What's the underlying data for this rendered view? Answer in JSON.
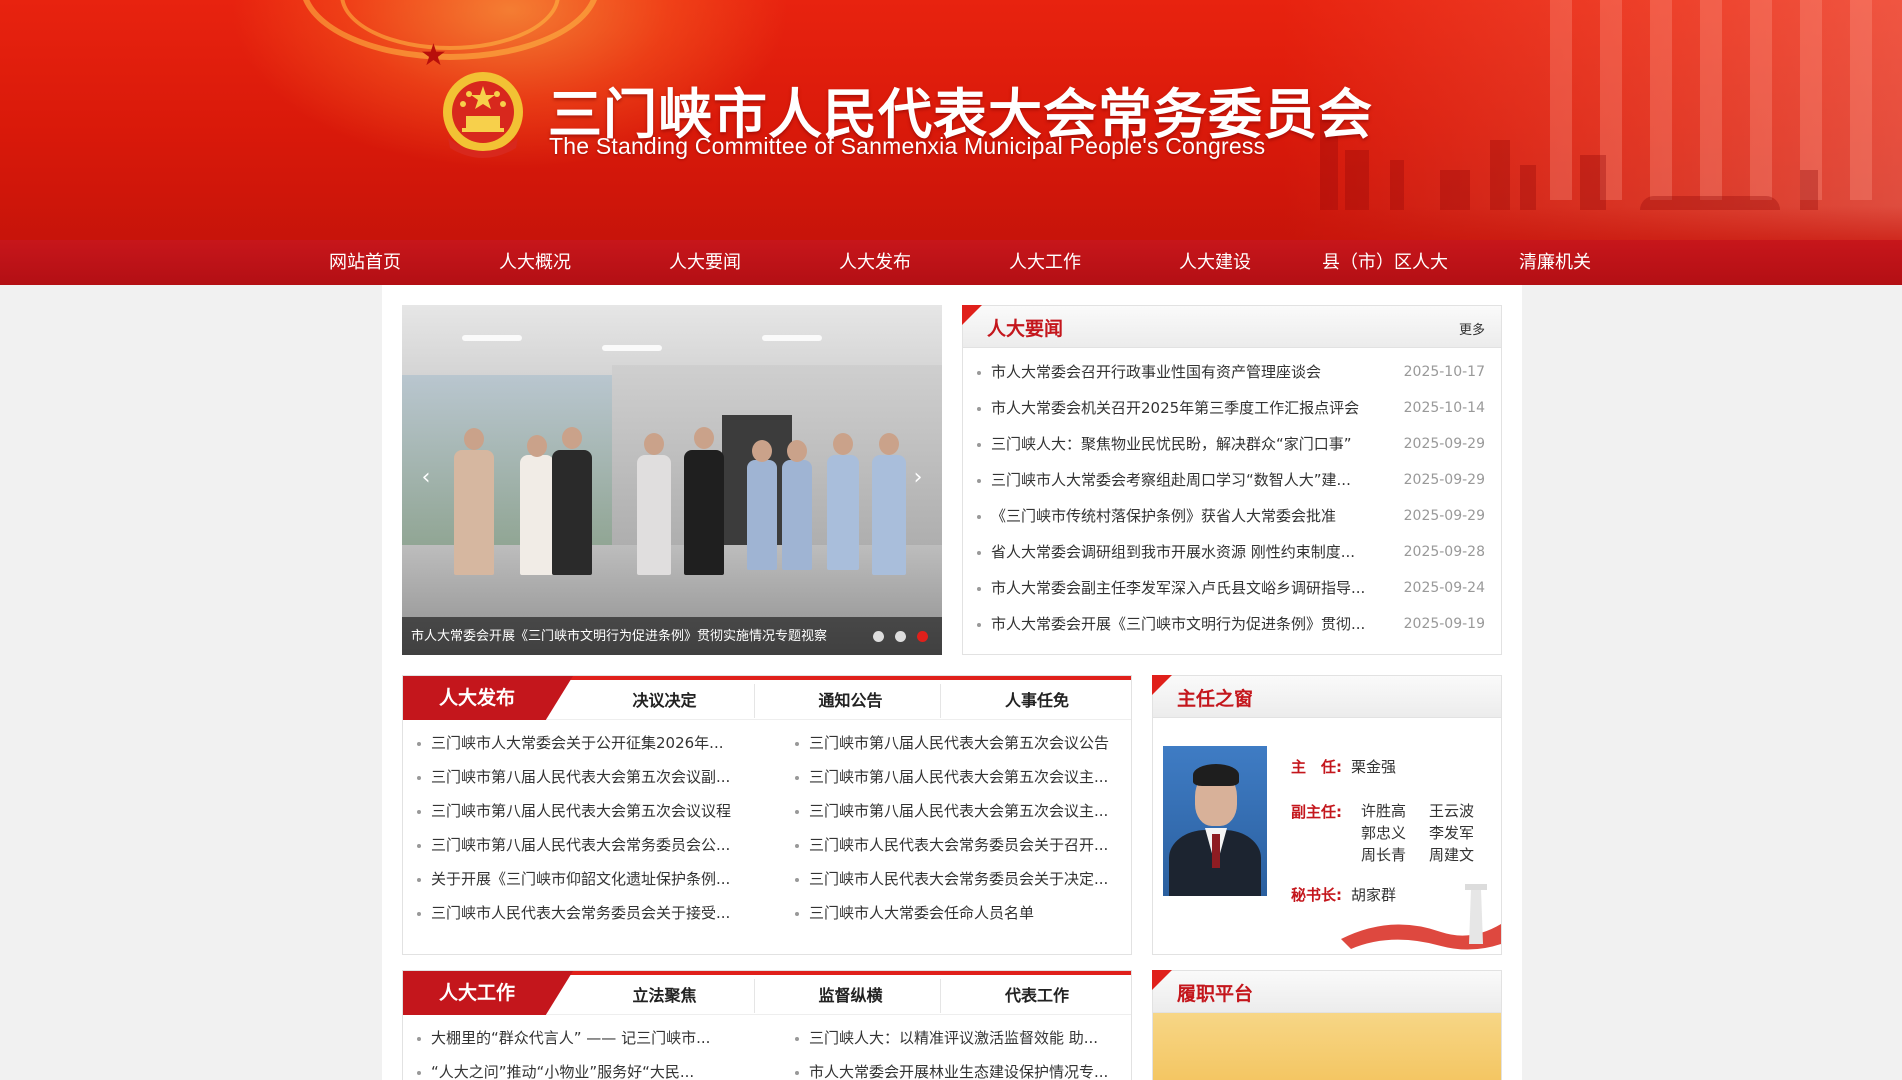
{
  "header": {
    "title_cn": "三门峡市人民代表大会常务委员会",
    "title_en": "The Standing Committee of Sanmenxia Municipal People's Congress"
  },
  "nav": {
    "items": [
      "网站首页",
      "人大概况",
      "人大要闻",
      "人大发布",
      "人大工作",
      "人大建设",
      "县（市）区人大",
      "清廉机关"
    ]
  },
  "slider": {
    "caption": "市人大常委会开展《三门峡市文明行为促进条例》贯彻实施情况专题视察",
    "dots": 3,
    "active_dot": 3
  },
  "news": {
    "title": "人大要闻",
    "more": "更多",
    "items": [
      {
        "title": "市人大常委会召开行政事业性国有资产管理座谈会",
        "date": "2025-10-17"
      },
      {
        "title": "市人大常委会机关召开2025年第三季度工作汇报点评会",
        "date": "2025-10-14"
      },
      {
        "title": "三门峡人大：聚焦物业民忧民盼，解决群众“家门口事”",
        "date": "2025-09-29"
      },
      {
        "title": "三门峡市人大常委会考察组赴周口学习“数智人大”建...",
        "date": "2025-09-29"
      },
      {
        "title": "《三门峡市传统村落保护条例》获省人大常委会批准",
        "date": "2025-09-29"
      },
      {
        "title": "省人大常委会调研组到我市开展水资源 刚性约束制度...",
        "date": "2025-09-28"
      },
      {
        "title": "市人大常委会副主任李发军深入卢氏县文峪乡调研指导...",
        "date": "2025-09-24"
      },
      {
        "title": "市人大常委会开展《三门峡市文明行为促进条例》贯彻...",
        "date": "2025-09-19"
      }
    ]
  },
  "publish": {
    "title": "人大发布",
    "tabs": [
      "决议决定",
      "通知公告",
      "人事任免"
    ],
    "left": [
      "三门峡市人大常委会关于公开征集2026年...",
      "三门峡市第八届人民代表大会第五次会议副...",
      "三门峡市第八届人民代表大会第五次会议议程",
      "三门峡市第八届人民代表大会常务委员会公...",
      "关于开展《三门峡市仰韶文化遗址保护条例...",
      "三门峡市人民代表大会常务委员会关于接受..."
    ],
    "right": [
      "三门峡市第八届人民代表大会第五次会议公告",
      "三门峡市第八届人民代表大会第五次会议主...",
      "三门峡市第八届人民代表大会第五次会议主...",
      "三门峡市人民代表大会常务委员会关于召开...",
      "三门峡市人民代表大会常务委员会关于决定...",
      "三门峡市人大常委会任命人员名单"
    ]
  },
  "director": {
    "title": "主任之窗",
    "director_label": "主　任:",
    "director_name": "栗金强",
    "deputy_label": "副主任:",
    "deputies": [
      "许胜高",
      "王云波",
      "郭忠义",
      "李发军",
      "周长青",
      "周建文"
    ],
    "secretary_label": "秘书长:",
    "secretary_name": "胡家群"
  },
  "work": {
    "title": "人大工作",
    "tabs": [
      "立法聚焦",
      "监督纵横",
      "代表工作"
    ],
    "left": [
      "大棚里的“群众代言人” —— 记三门峡市...",
      "“人大之问”推动“小物业”服务好“大民..."
    ],
    "right": [
      "三门峡人大：以精准评议激活监督效能 助...",
      "市人大常委会开展林业生态建设保护情况专..."
    ]
  },
  "platform": {
    "title": "履职平台"
  },
  "colors": {
    "brand_red": "#c4161c",
    "accent_red": "#e0201b",
    "nav_red": "#b30f14"
  }
}
